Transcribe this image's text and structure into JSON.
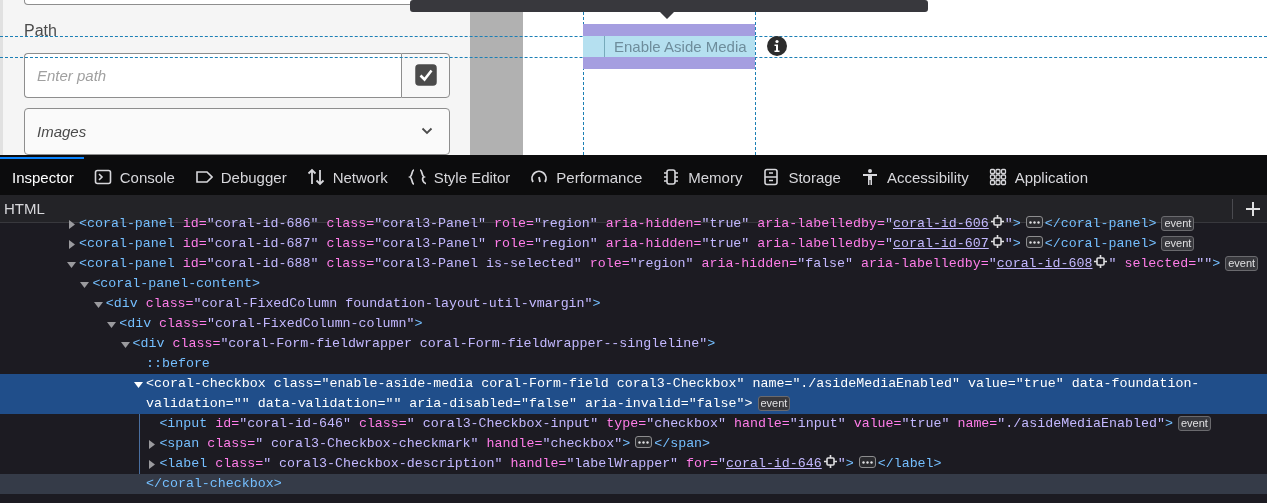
{
  "form": {
    "path_label": "Path",
    "path_field": {
      "placeholder": "Enter path"
    },
    "path_button": {
      "checked": true
    },
    "dropdown": {
      "value": "Images"
    }
  },
  "preview": {
    "checkbox": {
      "label": "Enable Aside Media",
      "checked": false,
      "highlighted": true
    }
  },
  "devtools": {
    "tabs": [
      {
        "label": "Inspector",
        "selected": true
      },
      {
        "label": "Console",
        "selected": false
      },
      {
        "label": "Debugger",
        "selected": false
      },
      {
        "label": "Network",
        "selected": false
      },
      {
        "label": "Style Editor",
        "selected": false
      },
      {
        "label": "Performance",
        "selected": false
      },
      {
        "label": "Memory",
        "selected": false
      },
      {
        "label": "Storage",
        "selected": false
      },
      {
        "label": "Accessibility",
        "selected": false
      },
      {
        "label": "Application",
        "selected": false
      }
    ],
    "panel_title": "HTML",
    "nodes": [
      {
        "expanded": false,
        "selected": false,
        "tokens": [
          {
            "kind": "tag",
            "text": "<coral-panel"
          },
          {
            "kind": "attr",
            "text": " id="
          },
          {
            "kind": "val",
            "text": "\"coral-id-686\""
          },
          {
            "kind": "attr",
            "text": " class="
          },
          {
            "kind": "val",
            "text": "\"coral3-Panel\""
          },
          {
            "kind": "attr",
            "text": " role="
          },
          {
            "kind": "val",
            "text": "\"region\""
          },
          {
            "kind": "attr",
            "text": " aria-hidden="
          },
          {
            "kind": "val",
            "text": "\"true\""
          },
          {
            "kind": "attr",
            "text": " aria-labelledby="
          },
          {
            "kind": "val",
            "text": "\""
          },
          {
            "kind": "link",
            "text": "coral-id-606"
          },
          {
            "kind": "icon"
          },
          {
            "kind": "val",
            "text": "\""
          },
          {
            "kind": "tag",
            "text": ">"
          },
          {
            "kind": "ell"
          },
          {
            "kind": "tag",
            "text": "</coral-panel>"
          },
          {
            "kind": "badge",
            "text": "event"
          }
        ]
      },
      {
        "expanded": false,
        "selected": false,
        "tokens": [
          {
            "kind": "tag",
            "text": "<coral-panel"
          },
          {
            "kind": "attr",
            "text": " id="
          },
          {
            "kind": "val",
            "text": "\"coral-id-687\""
          },
          {
            "kind": "attr",
            "text": " class="
          },
          {
            "kind": "val",
            "text": "\"coral3-Panel\""
          },
          {
            "kind": "attr",
            "text": " role="
          },
          {
            "kind": "val",
            "text": "\"region\""
          },
          {
            "kind": "attr",
            "text": " aria-hidden="
          },
          {
            "kind": "val",
            "text": "\"true\""
          },
          {
            "kind": "attr",
            "text": " aria-labelledby="
          },
          {
            "kind": "val",
            "text": "\""
          },
          {
            "kind": "link",
            "text": "coral-id-607"
          },
          {
            "kind": "icon"
          },
          {
            "kind": "val",
            "text": "\""
          },
          {
            "kind": "tag",
            "text": ">"
          },
          {
            "kind": "ell"
          },
          {
            "kind": "tag",
            "text": "</coral-panel>"
          },
          {
            "kind": "badge",
            "text": "event"
          }
        ]
      },
      {
        "expanded": true,
        "selected": false,
        "tokens": [
          {
            "kind": "tag",
            "text": "<coral-panel"
          },
          {
            "kind": "attr",
            "text": " id="
          },
          {
            "kind": "val",
            "text": "\"coral-id-688\""
          },
          {
            "kind": "attr",
            "text": " class="
          },
          {
            "kind": "val",
            "text": "\"coral3-Panel is-selected\""
          },
          {
            "kind": "attr",
            "text": " role="
          },
          {
            "kind": "val",
            "text": "\"region\""
          },
          {
            "kind": "attr",
            "text": " aria-hidden="
          },
          {
            "kind": "val",
            "text": "\"false\""
          },
          {
            "kind": "attr",
            "text": " aria-labelledby="
          },
          {
            "kind": "val",
            "text": "\""
          },
          {
            "kind": "link",
            "text": "coral-id-608"
          },
          {
            "kind": "icon"
          },
          {
            "kind": "val",
            "text": "\""
          },
          {
            "kind": "attr",
            "text": " selected="
          },
          {
            "kind": "val",
            "text": "\"\""
          },
          {
            "kind": "tag",
            "text": ">"
          },
          {
            "kind": "badge",
            "text": "event"
          }
        ],
        "children": [
          {
            "expanded": true,
            "selected": false,
            "tokens": [
              {
                "kind": "tag",
                "text": "<coral-panel-content>"
              }
            ],
            "children": [
              {
                "expanded": true,
                "selected": false,
                "tokens": [
                  {
                    "kind": "tag",
                    "text": "<div"
                  },
                  {
                    "kind": "attr",
                    "text": " class="
                  },
                  {
                    "kind": "val",
                    "text": "\"coral-FixedColumn foundation-layout-util-vmargin\""
                  },
                  {
                    "kind": "tag",
                    "text": ">"
                  }
                ],
                "children": [
                  {
                    "expanded": true,
                    "selected": false,
                    "tokens": [
                      {
                        "kind": "tag",
                        "text": "<div"
                      },
                      {
                        "kind": "attr",
                        "text": " class="
                      },
                      {
                        "kind": "val",
                        "text": "\"coral-FixedColumn-column\""
                      },
                      {
                        "kind": "tag",
                        "text": ">"
                      }
                    ],
                    "children": [
                      {
                        "expanded": true,
                        "selected": false,
                        "tokens": [
                          {
                            "kind": "tag",
                            "text": "<div"
                          },
                          {
                            "kind": "attr",
                            "text": " class="
                          },
                          {
                            "kind": "val",
                            "text": "\"coral-Form-fieldwrapper coral-Form-fieldwrapper--singleline\""
                          },
                          {
                            "kind": "tag",
                            "text": ">"
                          }
                        ],
                        "children": [
                          {
                            "selected": false,
                            "tokens": [
                              {
                                "kind": "pseudo",
                                "text": "::before"
                              }
                            ]
                          },
                          {
                            "expanded": true,
                            "selected": true,
                            "tokens": [
                              {
                                "kind": "tag",
                                "text": "<coral-checkbox"
                              },
                              {
                                "kind": "attr",
                                "text": " class="
                              },
                              {
                                "kind": "val",
                                "text": "\"enable-aside-media coral-Form-field coral3-Checkbox\""
                              },
                              {
                                "kind": "attr",
                                "text": " name="
                              },
                              {
                                "kind": "val",
                                "text": "\"./asideMediaEnabled\""
                              },
                              {
                                "kind": "attr",
                                "text": " value="
                              },
                              {
                                "kind": "val",
                                "text": "\"true\""
                              },
                              {
                                "kind": "attr",
                                "text": " data-foundation-validation="
                              },
                              {
                                "kind": "val",
                                "text": "\"\""
                              },
                              {
                                "kind": "attr",
                                "text": " data-validation="
                              },
                              {
                                "kind": "val",
                                "text": "\"\""
                              },
                              {
                                "kind": "attr",
                                "text": " aria-disabled="
                              },
                              {
                                "kind": "val",
                                "text": "\"false\""
                              },
                              {
                                "kind": "attr",
                                "text": " aria-invalid="
                              },
                              {
                                "kind": "val",
                                "text": "\"false\""
                              },
                              {
                                "kind": "tag",
                                "text": ">"
                              },
                              {
                                "kind": "badge",
                                "text": "event"
                              }
                            ],
                            "closing": {
                              "text": "</coral-checkbox>",
                              "hovered": true
                            },
                            "children": [
                              {
                                "selected": false,
                                "tokens": [
                                  {
                                    "kind": "tag",
                                    "text": "<input"
                                  },
                                  {
                                    "kind": "attr",
                                    "text": " id="
                                  },
                                  {
                                    "kind": "val",
                                    "text": "\"coral-id-646\""
                                  },
                                  {
                                    "kind": "attr",
                                    "text": " class="
                                  },
                                  {
                                    "kind": "val",
                                    "text": "\" coral3-Checkbox-input\""
                                  },
                                  {
                                    "kind": "attr",
                                    "text": " type="
                                  },
                                  {
                                    "kind": "val",
                                    "text": "\"checkbox\""
                                  },
                                  {
                                    "kind": "attr",
                                    "text": " handle="
                                  },
                                  {
                                    "kind": "val",
                                    "text": "\"input\""
                                  },
                                  {
                                    "kind": "attr",
                                    "text": " value="
                                  },
                                  {
                                    "kind": "val",
                                    "text": "\"true\""
                                  },
                                  {
                                    "kind": "attr",
                                    "text": " name="
                                  },
                                  {
                                    "kind": "val",
                                    "text": "\"./asideMediaEnabled\""
                                  },
                                  {
                                    "kind": "tag",
                                    "text": ">"
                                  },
                                  {
                                    "kind": "badge",
                                    "text": "event"
                                  }
                                ]
                              },
                              {
                                "expanded": false,
                                "selected": false,
                                "tokens": [
                                  {
                                    "kind": "tag",
                                    "text": "<span"
                                  },
                                  {
                                    "kind": "attr",
                                    "text": " class="
                                  },
                                  {
                                    "kind": "val",
                                    "text": "\" coral3-Checkbox-checkmark\""
                                  },
                                  {
                                    "kind": "attr",
                                    "text": " handle="
                                  },
                                  {
                                    "kind": "val",
                                    "text": "\"checkbox\""
                                  },
                                  {
                                    "kind": "tag",
                                    "text": ">"
                                  },
                                  {
                                    "kind": "ell"
                                  },
                                  {
                                    "kind": "tag",
                                    "text": "</span>"
                                  }
                                ]
                              },
                              {
                                "expanded": false,
                                "selected": false,
                                "tokens": [
                                  {
                                    "kind": "tag",
                                    "text": "<label"
                                  },
                                  {
                                    "kind": "attr",
                                    "text": " class="
                                  },
                                  {
                                    "kind": "val",
                                    "text": "\" coral3-Checkbox-description\""
                                  },
                                  {
                                    "kind": "attr",
                                    "text": " handle="
                                  },
                                  {
                                    "kind": "val",
                                    "text": "\"labelWrapper\""
                                  },
                                  {
                                    "kind": "attr",
                                    "text": " for="
                                  },
                                  {
                                    "kind": "val",
                                    "text": "\""
                                  },
                                  {
                                    "kind": "link",
                                    "text": "coral-id-646"
                                  },
                                  {
                                    "kind": "icon"
                                  },
                                  {
                                    "kind": "val",
                                    "text": "\""
                                  },
                                  {
                                    "kind": "tag",
                                    "text": ">"
                                  },
                                  {
                                    "kind": "ell"
                                  },
                                  {
                                    "kind": "tag",
                                    "text": "</label>"
                                  }
                                ]
                              }
                            ]
                          }
                        ]
                      }
                    ]
                  }
                ]
              }
            ]
          }
        ]
      }
    ]
  }
}
